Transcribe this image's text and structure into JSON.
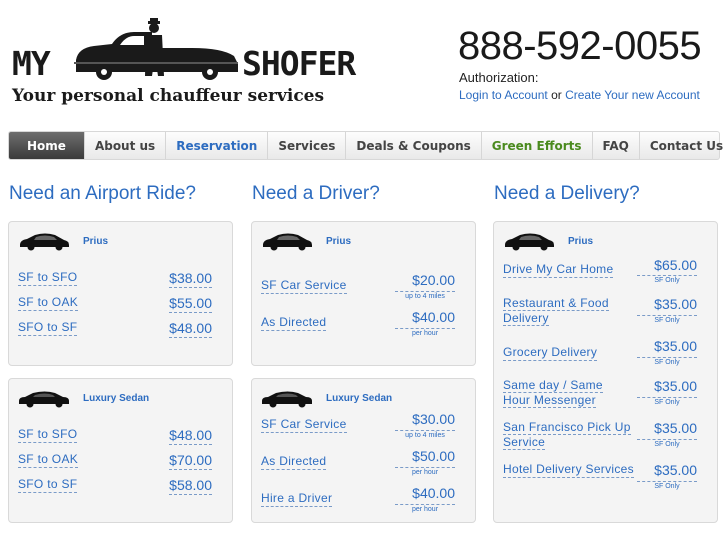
{
  "brand": {
    "word1": "MY",
    "word2": "SHOFER",
    "tagline": "Your personal chauffeur services"
  },
  "contact": {
    "phone": "888-592-0055",
    "auth_label": "Authorization:",
    "login": "Login to Account",
    "or": "or",
    "create": "Create Your new Account"
  },
  "nav": [
    "Home",
    "About us",
    "Reservation",
    "Services",
    "Deals & Coupons",
    "Green Efforts",
    "FAQ",
    "Contact Us"
  ],
  "columns": {
    "airport": {
      "title": "Need an Airport Ride?",
      "prius": {
        "car": "Prius",
        "rows": [
          {
            "label": "SF to SFO",
            "price": "$38.00"
          },
          {
            "label": "SF to OAK",
            "price": "$55.00"
          },
          {
            "label": "SFO to SF",
            "price": "$48.00"
          }
        ]
      },
      "sedan": {
        "car": "Luxury Sedan",
        "rows": [
          {
            "label": "SF to SFO",
            "price": "$48.00"
          },
          {
            "label": "SF to OAK",
            "price": "$70.00"
          },
          {
            "label": "SFO to SF",
            "price": "$58.00"
          }
        ]
      }
    },
    "driver": {
      "title": "Need a Driver?",
      "prius": {
        "car": "Prius",
        "rows": [
          {
            "label": "SF Car Service",
            "price": "$20.00",
            "note": "up to 4 miles"
          },
          {
            "label": "As Directed",
            "price": "$40.00",
            "note": "per hour"
          }
        ]
      },
      "sedan": {
        "car": "Luxury Sedan",
        "rows": [
          {
            "label": "SF Car Service",
            "price": "$30.00",
            "note": "up to 4 miles"
          },
          {
            "label": "As Directed",
            "price": "$50.00",
            "note": "per hour"
          },
          {
            "label": "Hire a Driver",
            "price": "$40.00",
            "note": "per hour"
          }
        ]
      }
    },
    "delivery": {
      "title": "Need a Delivery?",
      "prius": {
        "car": "Prius",
        "rows": [
          {
            "label": "Drive My Car Home",
            "price": "$65.00",
            "note": "SF Only"
          },
          {
            "label": "Restaurant & Food Delivery",
            "price": "$35.00",
            "note": "SF Only"
          },
          {
            "label": "Grocery Delivery",
            "price": "$35.00",
            "note": "SF Only"
          },
          {
            "label": "Same day / Same Hour Messenger",
            "price": "$35.00",
            "note": "SF Only"
          },
          {
            "label": "San Francisco Pick Up Service",
            "price": "$35.00",
            "note": "SF Only"
          },
          {
            "label": "Hotel Delivery Services",
            "price": "$35.00",
            "note": "SF Only"
          }
        ]
      }
    }
  },
  "colors": {
    "link": "#2d6cc0",
    "green": "#4a8a1e",
    "card_bg": "#f4f4f4"
  }
}
